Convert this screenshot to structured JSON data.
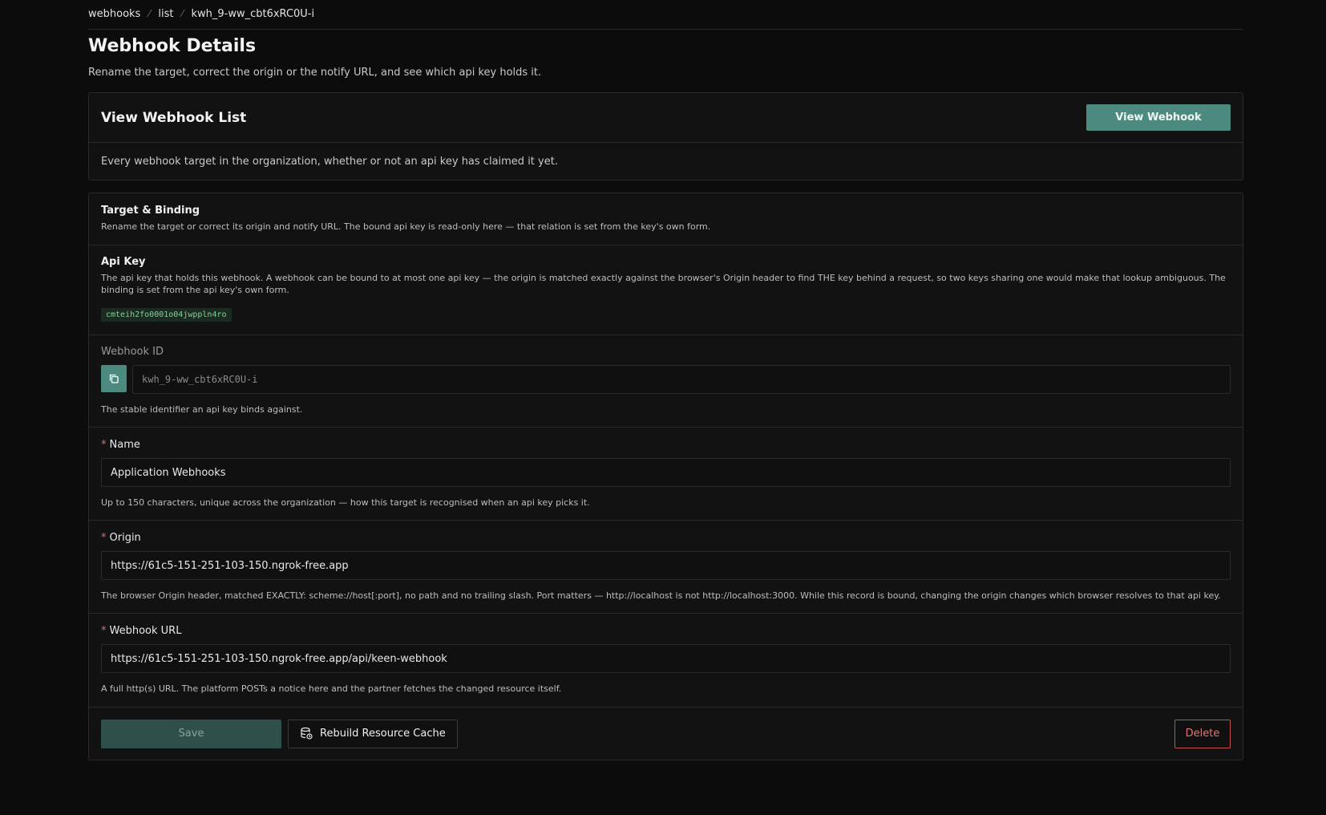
{
  "breadcrumb": {
    "items": [
      "webhooks",
      "list",
      "kwh_9-ww_cbt6xRC0U-i"
    ],
    "separator": "⁄"
  },
  "page": {
    "title": "Webhook Details",
    "subtitle": "Rename the target, correct the origin or the notify URL, and see which api key holds it."
  },
  "list_card": {
    "title": "View Webhook List",
    "button_label": "View Webhook",
    "description": "Every webhook target in the organization, whether or not an api key has claimed it yet."
  },
  "form": {
    "section": {
      "title": "Target & Binding",
      "description": "Rename the target or correct its origin and notify URL. The bound api key is read-only here — that relation is set from the key's own form."
    },
    "api_key": {
      "label": "Api Key",
      "description": "The api key that holds this webhook. A webhook can be bound to at most one api key — the origin is matched exactly against the browser's Origin header to find THE key behind a request, so two keys sharing one would make that lookup ambiguous. The binding is set from the api key's own form.",
      "value": "cmteih2fo0001o04jwppln4ro"
    },
    "webhook_id": {
      "label": "Webhook ID",
      "value": "kwh_9-ww_cbt6xRC0U-i",
      "help": "The stable identifier an api key binds against."
    },
    "name": {
      "required_mark": "*",
      "label": "Name",
      "value": "Application Webhooks",
      "help": "Up to 150 characters, unique across the organization — how this target is recognised when an api key picks it."
    },
    "origin": {
      "required_mark": "*",
      "label": "Origin",
      "value": "https://61c5-151-251-103-150.ngrok-free.app",
      "help": "The browser Origin header, matched EXACTLY: scheme://host[:port], no path and no trailing slash. Port matters — http://localhost is not http://localhost:3000. While this record is bound, changing the origin changes which browser resolves to that api key."
    },
    "webhook_url": {
      "required_mark": "*",
      "label": "Webhook URL",
      "value": "https://61c5-151-251-103-150.ngrok-free.app/api/keen-webhook",
      "help": "A full http(s) URL. The platform POSTs a notice here and the partner fetches the changed resource itself."
    }
  },
  "footer": {
    "save_label": "Save",
    "rebuild_label": "Rebuild Resource Cache",
    "delete_label": "Delete"
  },
  "colors": {
    "accent": "#4c8a80",
    "danger": "#c44e4e",
    "background": "#0c0c0d"
  },
  "icons": {
    "copy": "copy-icon",
    "rebuild": "database-refresh-icon"
  }
}
